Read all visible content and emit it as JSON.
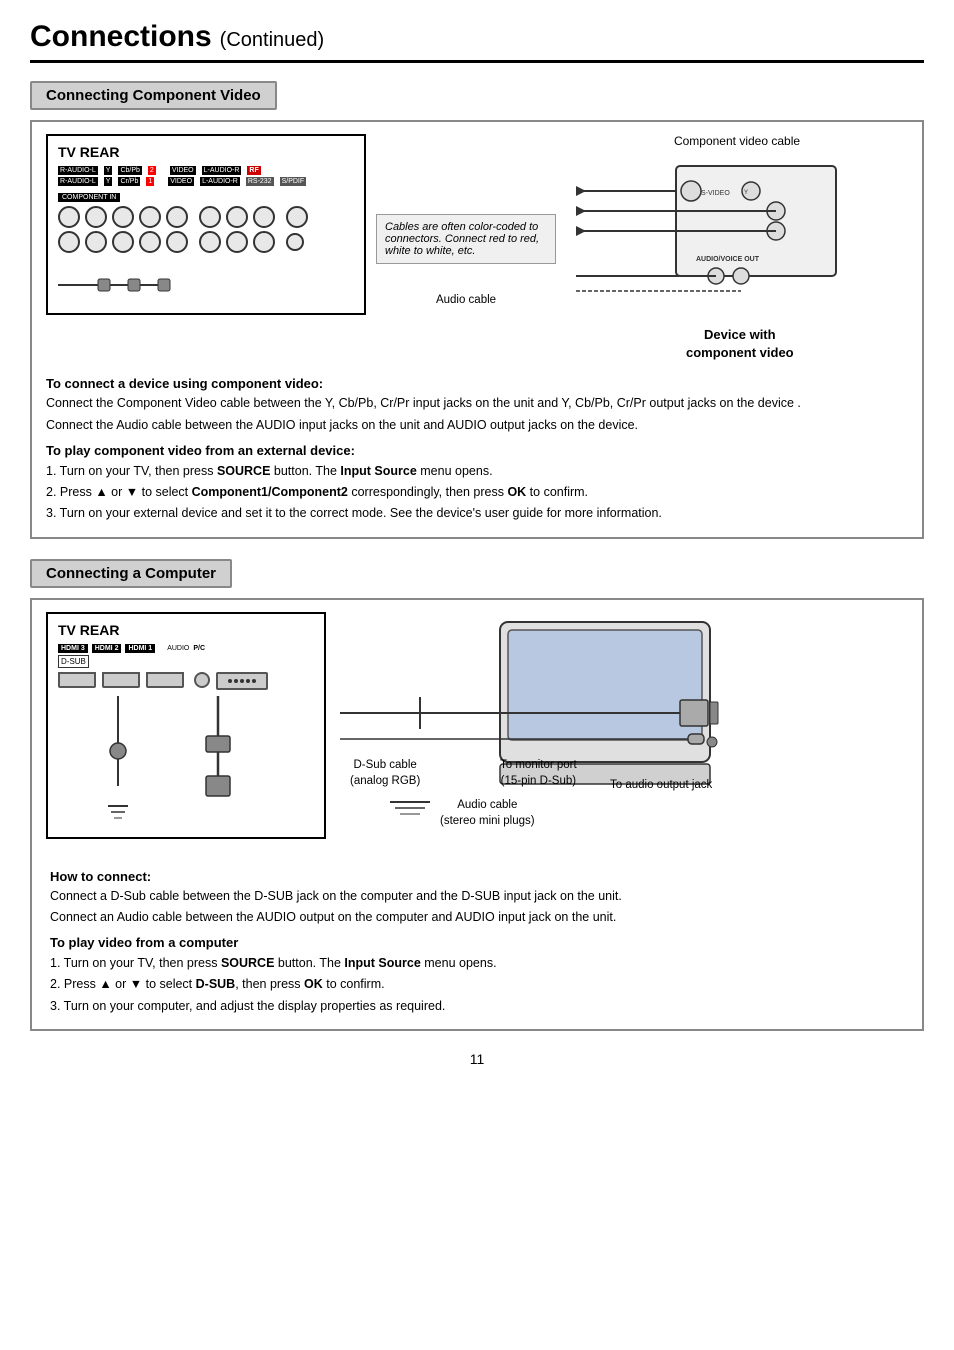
{
  "page": {
    "title": "Connections",
    "subtitle": "(Continued)",
    "page_number": "11"
  },
  "section1": {
    "header": "Connecting Component Video",
    "tv_rear_label": "TV REAR",
    "component_video_cable_label": "Component video cable",
    "audio_cable_label": "Audio cable",
    "device_label": "Device with\ncomponent video",
    "cable_note": "Cables are often color-coded to connectors. Connect red to red, white to white, etc.",
    "instruction1_heading": "To connect a device using component video:",
    "instruction1_text1": "Connect the Component Video cable between the Y, Cb/Pb, Cr/Pr input jacks on the unit and Y, Cb/Pb, Cr/Pr output jacks on the device .",
    "instruction1_text2": "Connect the Audio cable between the AUDIO input jacks on the unit and AUDIO output jacks on the device.",
    "instruction2_heading": "To play component video from an external device:",
    "instruction2_steps": [
      "1. Turn on your TV,  then press SOURCE button. The Input Source menu opens.",
      "2. Press ▲ or ▼ to select Component1/Component2 correspondingly, then press OK to confirm.",
      "3. Turn on your external device and set it to the correct mode. See the device's user guide for more information."
    ]
  },
  "section2": {
    "header": "Connecting a Computer",
    "tv_rear_label": "TV REAR",
    "dsub_cable_label": "D-Sub cable\n(analog RGB)",
    "monitor_port_label": "To monitor port\n(15-pin D-Sub)",
    "audio_cable_label": "Audio cable\n(stereo mini plugs)",
    "audio_output_label": "To audio output jack",
    "instruction1_heading": "How to connect:",
    "instruction1_text1": "Connect a D-Sub cable between the D-SUB jack on the computer and the D-SUB input jack on the unit.",
    "instruction1_text2": "Connect an Audio cable between  the AUDIO output on the computer and AUDIO input jack on the unit.",
    "instruction2_heading": "To play video from a computer",
    "instruction2_steps": [
      "1. Turn on your TV,  then press SOURCE button. The Input Source menu opens.",
      "2.  Press ▲ or ▼ to select D-SUB, then press OK to confirm.",
      "3.  Turn on your computer, and adjust the display properties as required."
    ]
  }
}
